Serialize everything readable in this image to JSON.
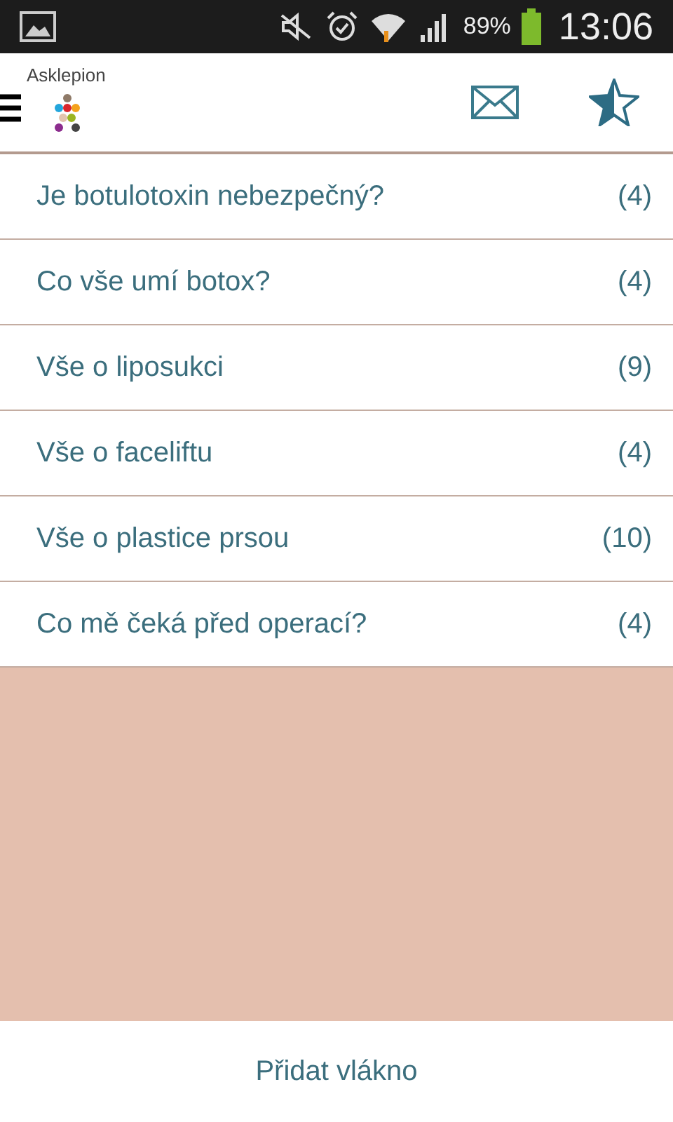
{
  "status_bar": {
    "battery": "89%",
    "time": "13:06"
  },
  "app_bar": {
    "logo_text": "Asklepion"
  },
  "topics": [
    {
      "title": "Je botulotoxin nebezpečný?",
      "count": "(4)"
    },
    {
      "title": "Co vše umí botox?",
      "count": "(4)"
    },
    {
      "title": "Vše o liposukci",
      "count": "(9)"
    },
    {
      "title": "Vše o faceliftu",
      "count": "(4)"
    },
    {
      "title": "Vše o plastice prsou",
      "count": "(10)"
    },
    {
      "title": "Co mě čeká před operací?",
      "count": "(4)"
    }
  ],
  "add_button": "Přidat vlákno"
}
